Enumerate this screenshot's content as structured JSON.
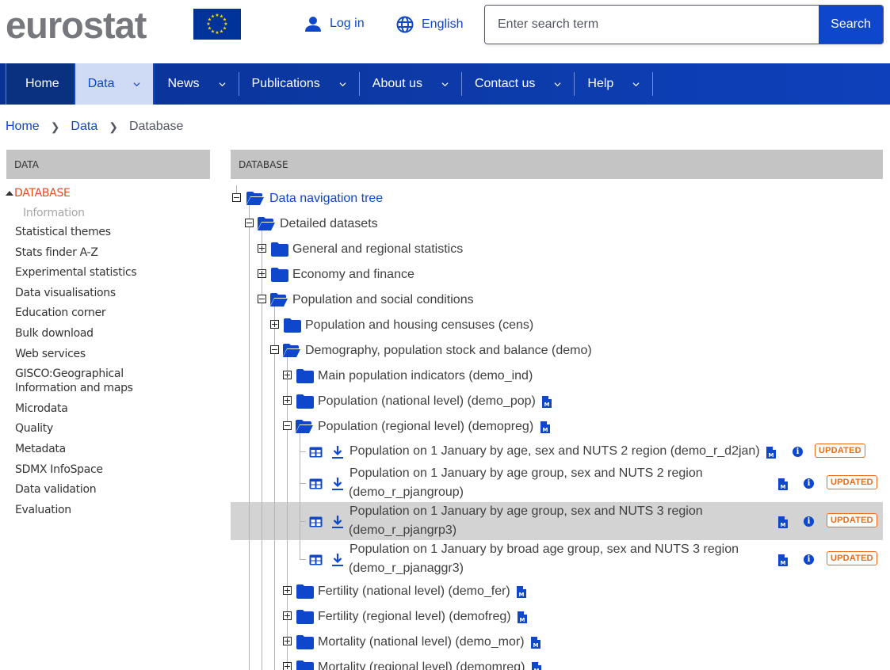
{
  "header": {
    "logo_text": "eurostat",
    "login_label": "Log in",
    "language_label": "English",
    "search_placeholder": "Enter search term",
    "search_button": "Search"
  },
  "nav": {
    "items": [
      {
        "label": "Home",
        "has_dropdown": false
      },
      {
        "label": "Data",
        "has_dropdown": true,
        "active": true
      },
      {
        "label": "News",
        "has_dropdown": true
      },
      {
        "label": "Publications",
        "has_dropdown": true
      },
      {
        "label": "About us",
        "has_dropdown": true
      },
      {
        "label": "Contact us",
        "has_dropdown": true
      },
      {
        "label": "Help",
        "has_dropdown": true
      }
    ]
  },
  "breadcrumb": [
    {
      "label": "Home"
    },
    {
      "label": "Data"
    },
    {
      "label": "Database"
    }
  ],
  "sidebar": {
    "heading": "DATA",
    "database_label": "DATABASE",
    "database_sub": "Information",
    "items": [
      "Statistical themes",
      "Stats finder A-Z",
      "Experimental statistics",
      "Data visualisations",
      "Education corner",
      "Bulk download",
      "Web services",
      "GISCO:Geographical Information and maps",
      "Microdata",
      "Quality",
      "Metadata",
      "SDMX InfoSpace",
      "Data validation",
      "Evaluation"
    ]
  },
  "main": {
    "heading": "DATABASE",
    "tree": {
      "root": "Data navigation tree",
      "detailed": "Detailed datasets",
      "general": "General and regional statistics",
      "economy": "Economy and finance",
      "population": "Population and social conditions",
      "cens": "Population and housing censuses (cens)",
      "demo": "Demography, population stock and balance (demo)",
      "demo_ind": "Main population indicators (demo_ind)",
      "demo_pop": "Population (national level) (demo_pop)",
      "demopreg": "Population (regional level) (demopreg)",
      "datasets": [
        {
          "title": "Population on 1 January by age, sex and NUTS 2 region (demo_r_d2jan)",
          "line1": "Population on 1 January by age, sex and NUTS 2 region (demo_r_d2jan)",
          "line2": "",
          "badge": "UPDATED",
          "highlighted": false
        },
        {
          "title": "Population on 1 January by age group, sex and NUTS 2 region (demo_r_pjangroup)",
          "line1": "Population on 1 January by age group, sex and NUTS 2 region",
          "line2": "(demo_r_pjangroup)",
          "badge": "UPDATED",
          "highlighted": false
        },
        {
          "title": "Population on 1 January by age group, sex and NUTS 3 region (demo_r_pjangrp3)",
          "line1": "Population on 1 January by age group, sex and NUTS 3 region",
          "line2": "(demo_r_pjangrp3)",
          "badge": "UPDATED",
          "highlighted": true
        },
        {
          "title": "Population on 1 January by broad age group, sex and NUTS 3 region (demo_r_pjanaggr3)",
          "line1": "Population on 1 January by broad age group, sex and NUTS 3 region",
          "line2": "(demo_r_pjanaggr3)",
          "badge": "UPDATED",
          "highlighted": false
        }
      ],
      "demo_fer": "Fertility (national level) (demo_fer)",
      "demofreg": "Fertility (regional level) (demofreg)",
      "demo_mor": "Mortality (national level) (demo_mor)",
      "demomreg": "Mortality (regional level) (demomreg)"
    }
  },
  "colors": {
    "brand_blue": "#0e47cb",
    "nav_blue": "#0c3aa8",
    "sidebar_active": "#e04e1b",
    "badge_orange": "#f06a0f"
  }
}
